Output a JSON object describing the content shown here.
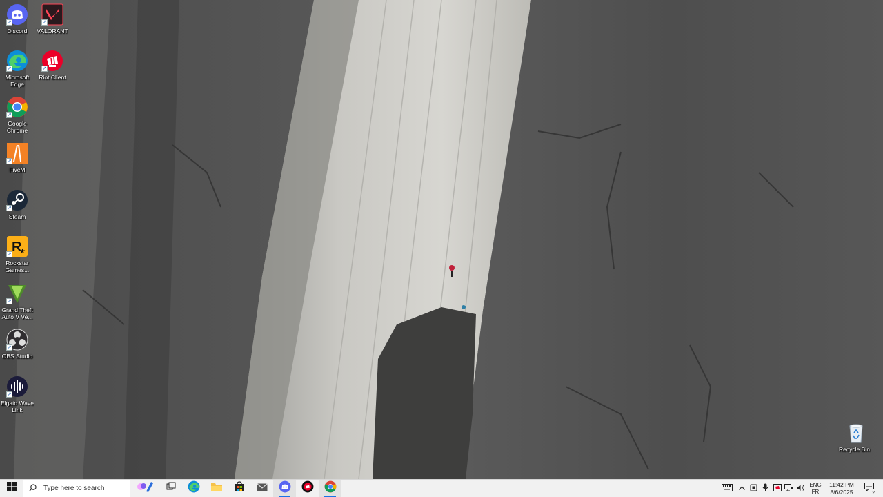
{
  "desktop": {
    "icons": [
      {
        "label": "Discord",
        "icon": "discord-icon",
        "color": "#5865f2"
      },
      {
        "label": "VALORANT",
        "icon": "valorant-icon",
        "color": "#fd4556"
      },
      {
        "label": "Microsoft Edge",
        "icon": "edge-icon",
        "color": "#0c8fd8"
      },
      {
        "label": "Riot Client",
        "icon": "riot-client-icon",
        "color": "#eb0029"
      },
      {
        "label": "Google Chrome",
        "icon": "chrome-icon",
        "color": "#34a853"
      },
      {
        "label": "FiveM",
        "icon": "fivem-icon",
        "color": "#f48225"
      },
      {
        "label": "Steam",
        "icon": "steam-icon",
        "color": "#1b2838"
      },
      {
        "label": "Rockstar Games...",
        "icon": "rockstar-icon",
        "color": "#fcaf17"
      },
      {
        "label": "Grand Theft Auto V Ve...",
        "icon": "gta-v-icon",
        "color": "#4e8c2a"
      },
      {
        "label": "OBS Studio",
        "icon": "obs-icon",
        "color": "#302e31"
      },
      {
        "label": "Elgato Wave Link",
        "icon": "elgato-wave-link-icon",
        "color": "#1b1b3a"
      },
      {
        "label": "Recycle Bin",
        "icon": "recycle-bin-icon",
        "color": "#2a7fd4"
      }
    ]
  },
  "taskbar": {
    "search_placeholder": "Type here to search",
    "apps": [
      "task-view-icon",
      "edge-icon",
      "file-explorer-icon",
      "microsoft-store-icon",
      "mail-icon",
      "discord-icon",
      "riot-client-icon",
      "chrome-icon"
    ],
    "tray": {
      "lang_line1": "ENG",
      "lang_line2": "FR",
      "time": "11:42 PM",
      "date": "8/6/2025",
      "notification_count": "2"
    }
  }
}
